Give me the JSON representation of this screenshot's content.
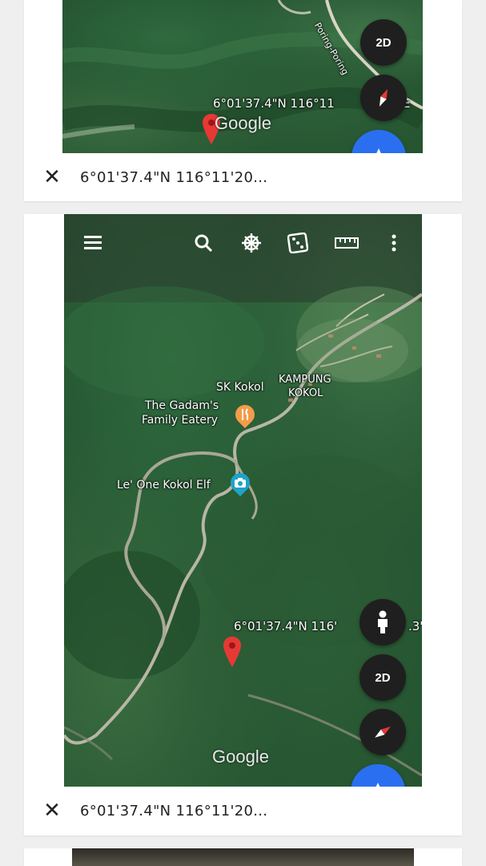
{
  "colors": {
    "accent_blue": "#2a6ff0",
    "pin_red": "#e53935",
    "food_orange": "#f39c4a",
    "camera_teal": "#1fa3c8"
  },
  "card1": {
    "overlay_coord": "6°01'37.4\"N 116°11",
    "overlay_coord_tail": "E",
    "road_label": "Poring-Poring",
    "google_logo": "Google",
    "btn_2d": "2D",
    "bottom_coord": "6°01'37.4\"N 116°11'20...",
    "close_label": "✕"
  },
  "card2": {
    "toolbar_icons": [
      "menu-icon",
      "search-icon",
      "compass-rose-icon",
      "dice-icon",
      "ruler-icon",
      "more-vert-icon"
    ],
    "places": {
      "sk_kokol": "SK Kokol",
      "kampung_line1": "KAMPUNG",
      "kampung_line2": "KOKOL",
      "eatery_line1": "The Gadam's",
      "eatery_line2": "Family Eatery",
      "le_one": "Le' One Kokol Elf"
    },
    "overlay_coord": "6°01'37.4\"N 116'",
    "overlay_coord_tail": ".3\"",
    "google_logo": "Google",
    "btn_2d": "2D",
    "bottom_coord": "6°01'37.4\"N 116°11'20...",
    "close_label": "✕"
  }
}
